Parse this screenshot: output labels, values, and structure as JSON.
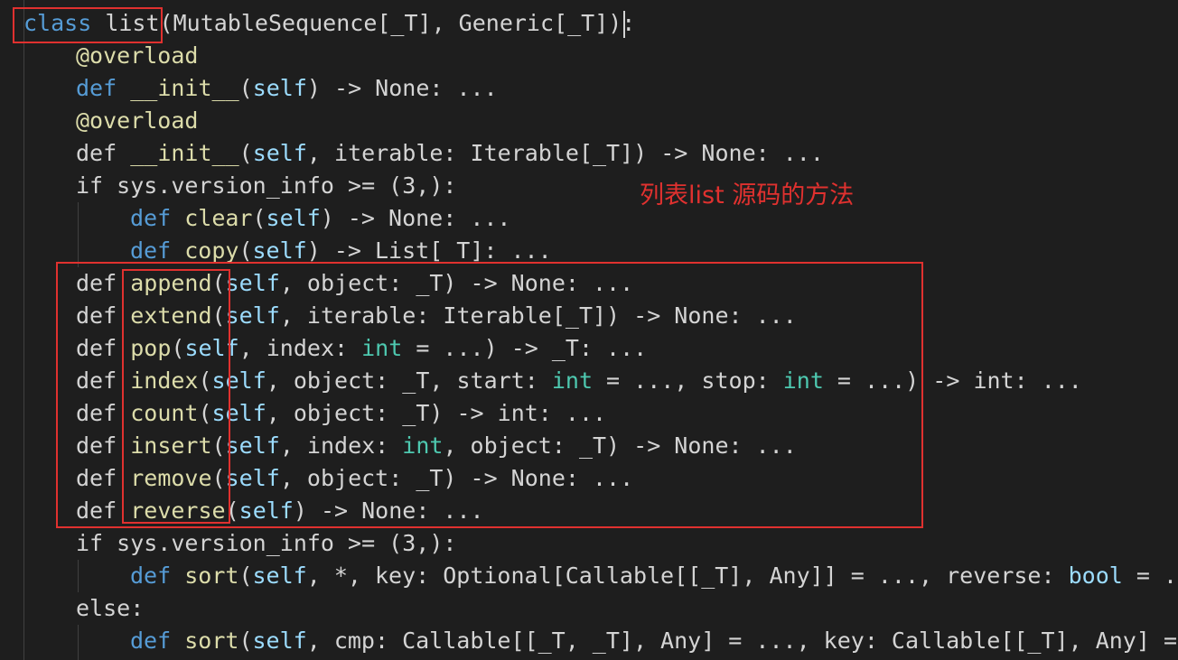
{
  "editor": {
    "annotation": "列表list 源码的方法",
    "accent_color": "#e0312f",
    "lines": [
      [
        [
          "kw",
          "class"
        ],
        [
          "plain",
          " "
        ],
        [
          "plain",
          "list"
        ],
        [
          "plain",
          "(MutableSequence[_T], Generic[_T]):"
        ]
      ],
      [
        [
          "deco",
          "@overload"
        ]
      ],
      [
        [
          "kw",
          "def"
        ],
        [
          "plain",
          " "
        ],
        [
          "fn",
          "__init__"
        ],
        [
          "plain",
          "("
        ],
        [
          "param",
          "self"
        ],
        [
          "plain",
          ") -> None: ..."
        ]
      ],
      [
        [
          "deco",
          "@overload"
        ]
      ],
      [
        [
          "plain",
          "def "
        ],
        [
          "fn",
          "__init__"
        ],
        [
          "plain",
          "("
        ],
        [
          "param",
          "self"
        ],
        [
          "plain",
          ", iterable: Iterable[_T]) -> None: ..."
        ]
      ],
      [
        [
          "plain",
          "if sys.version_info >= (3,):"
        ]
      ],
      [
        [
          "kw",
          "def"
        ],
        [
          "plain",
          " "
        ],
        [
          "fn",
          "clear"
        ],
        [
          "plain",
          "("
        ],
        [
          "param",
          "self"
        ],
        [
          "plain",
          ") -> None: ..."
        ]
      ],
      [
        [
          "kw",
          "def"
        ],
        [
          "plain",
          " "
        ],
        [
          "fn",
          "copy"
        ],
        [
          "plain",
          "("
        ],
        [
          "param",
          "self"
        ],
        [
          "plain",
          ") -> List[_T]: ..."
        ]
      ],
      [
        [
          "plain",
          "def "
        ],
        [
          "fn",
          "append"
        ],
        [
          "plain",
          "("
        ],
        [
          "param",
          "self"
        ],
        [
          "plain",
          ", object: _T) -> None: ..."
        ]
      ],
      [
        [
          "plain",
          "def "
        ],
        [
          "fn",
          "extend"
        ],
        [
          "plain",
          "("
        ],
        [
          "param",
          "self"
        ],
        [
          "plain",
          ", iterable: Iterable[_T]) -> None: ..."
        ]
      ],
      [
        [
          "plain",
          "def "
        ],
        [
          "fn",
          "pop"
        ],
        [
          "plain",
          "("
        ],
        [
          "param",
          "self"
        ],
        [
          "plain",
          ", index: "
        ],
        [
          "type",
          "int"
        ],
        [
          "plain",
          " = ...) -> _T: ..."
        ]
      ],
      [
        [
          "plain",
          "def "
        ],
        [
          "fn",
          "index"
        ],
        [
          "plain",
          "("
        ],
        [
          "param",
          "self"
        ],
        [
          "plain",
          ", object: _T, start: "
        ],
        [
          "type",
          "int"
        ],
        [
          "plain",
          " = ..., stop: "
        ],
        [
          "type",
          "int"
        ],
        [
          "plain",
          " = ...) -> int: ..."
        ]
      ],
      [
        [
          "plain",
          "def "
        ],
        [
          "fn",
          "count"
        ],
        [
          "plain",
          "("
        ],
        [
          "param",
          "self"
        ],
        [
          "plain",
          ", object: _T) -> int: ..."
        ]
      ],
      [
        [
          "plain",
          "def "
        ],
        [
          "fn",
          "insert"
        ],
        [
          "plain",
          "("
        ],
        [
          "param",
          "self"
        ],
        [
          "plain",
          ", index: "
        ],
        [
          "type",
          "int"
        ],
        [
          "plain",
          ", object: _T) -> None: ..."
        ]
      ],
      [
        [
          "plain",
          "def "
        ],
        [
          "fn",
          "remove"
        ],
        [
          "plain",
          "("
        ],
        [
          "param",
          "self"
        ],
        [
          "plain",
          ", object: _T) -> None: ..."
        ]
      ],
      [
        [
          "plain",
          "def "
        ],
        [
          "fn",
          "reverse"
        ],
        [
          "plain",
          "("
        ],
        [
          "param",
          "self"
        ],
        [
          "plain",
          ") -> None: ..."
        ]
      ],
      [
        [
          "plain",
          "if sys.version_info >= (3,):"
        ]
      ],
      [
        [
          "kw",
          "def"
        ],
        [
          "plain",
          " "
        ],
        [
          "fn",
          "sort"
        ],
        [
          "plain",
          "("
        ],
        [
          "param",
          "self"
        ],
        [
          "plain",
          ", *, key: Optional[Callable[[_T], Any]] = ..., reverse: "
        ],
        [
          "param",
          "bool"
        ],
        [
          "plain",
          " = .."
        ]
      ],
      [
        [
          "plain",
          "else:"
        ]
      ],
      [
        [
          "kw",
          "def"
        ],
        [
          "plain",
          " "
        ],
        [
          "fn",
          "sort"
        ],
        [
          "plain",
          "("
        ],
        [
          "param",
          "self"
        ],
        [
          "plain",
          ", cmp: Callable[[_T, _T], Any] = ..., key: Callable[[_T], Any] = "
        ]
      ]
    ]
  }
}
